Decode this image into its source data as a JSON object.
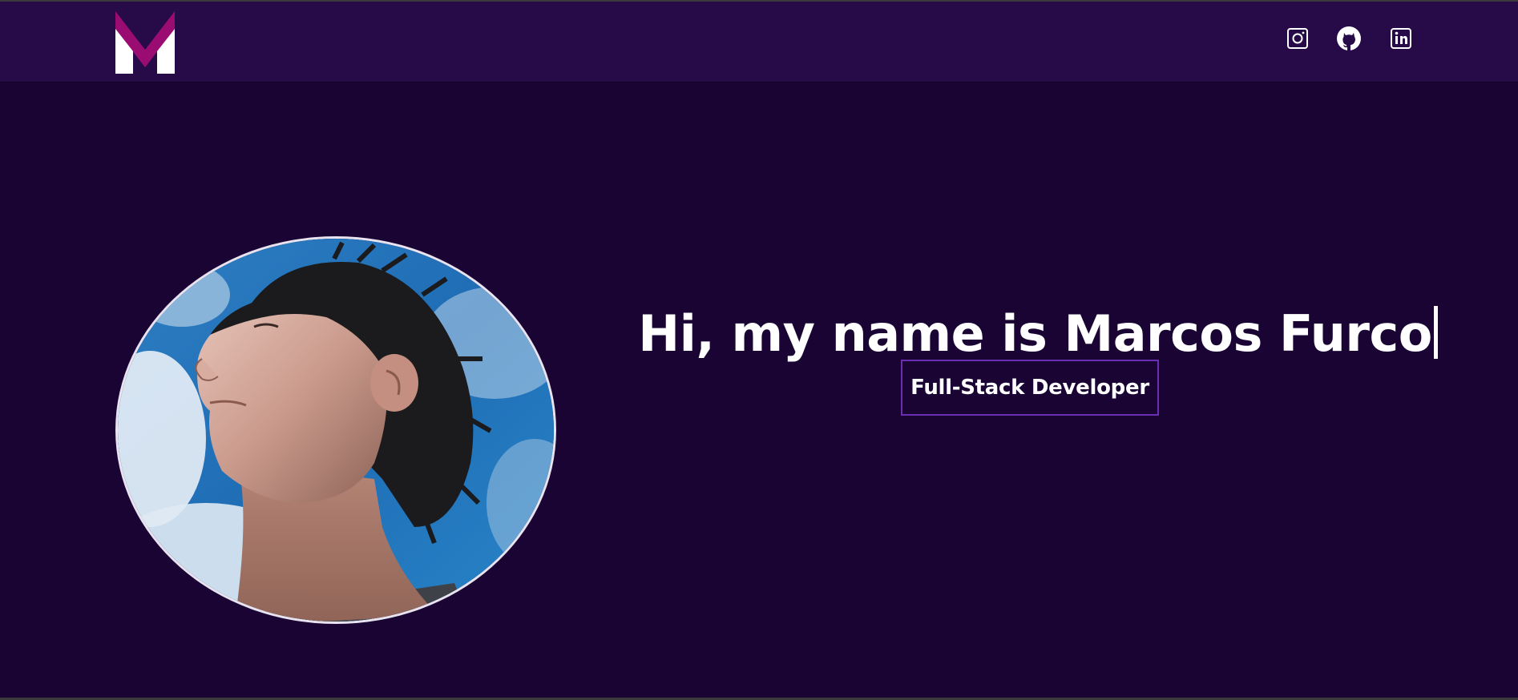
{
  "header": {
    "logo": {
      "icon": "m-logo-icon",
      "colors": {
        "accent": "#9a0c72",
        "light": "#ffffff"
      }
    },
    "social_links": [
      {
        "name": "instagram",
        "icon": "instagram-icon"
      },
      {
        "name": "github",
        "icon": "github-icon"
      },
      {
        "name": "linkedin",
        "icon": "linkedin-icon"
      }
    ]
  },
  "hero": {
    "greeting": "Hi, my name is Marcos Furco",
    "role": "Full-Stack Developer",
    "avatar": {
      "icon": "profile-photo"
    }
  },
  "colors": {
    "background": "#190433",
    "navbar": "#260b48",
    "badge_border": "#6a2fb0",
    "text": "#ffffff"
  }
}
